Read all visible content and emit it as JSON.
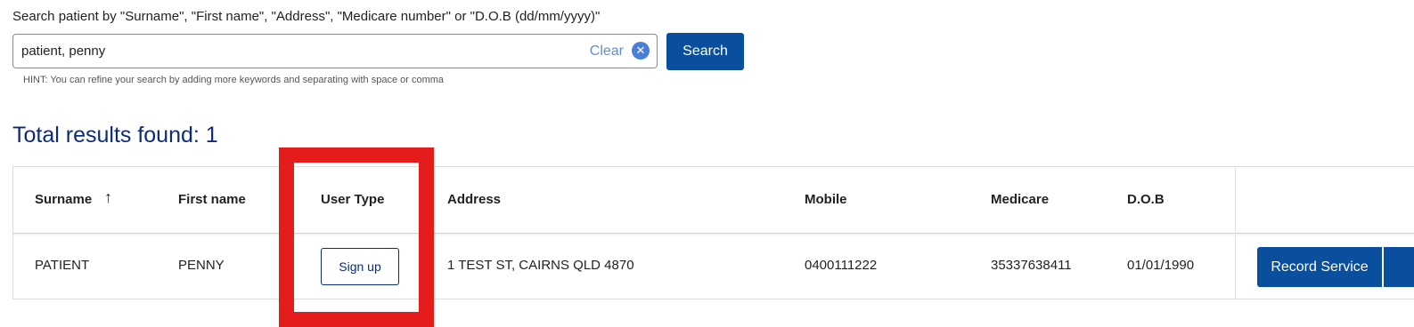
{
  "search": {
    "label": "Search patient by \"Surname\", \"First name\", \"Address\", \"Medicare number\" or \"D.O.B (dd/mm/yyyy)\"",
    "value": "patient, penny",
    "clear_label": "Clear",
    "clear_icon": "close-circle-icon",
    "button_label": "Search",
    "hint": "HINT: You can refine your search by adding more keywords and separating with space or comma"
  },
  "results": {
    "title": "Total results found: 1"
  },
  "table": {
    "headers": {
      "surname": "Surname",
      "first_name": "First name",
      "user_type": "User Type",
      "address": "Address",
      "mobile": "Mobile",
      "medicare": "Medicare",
      "dob": "D.O.B"
    },
    "sort_icon": "↑",
    "rows": [
      {
        "surname": "PATIENT",
        "first_name": "PENNY",
        "user_type_action": "Sign up",
        "address": "1 TEST ST, CAIRNS QLD 4870",
        "mobile": "0400111222",
        "medicare": "35337638411",
        "dob": "01/01/1990",
        "action": "Record Service"
      }
    ]
  },
  "colors": {
    "primary": "#0a4f9e",
    "title": "#0d2b7c",
    "clear_link": "#5b8fd6",
    "highlight": "#e41c1c"
  }
}
